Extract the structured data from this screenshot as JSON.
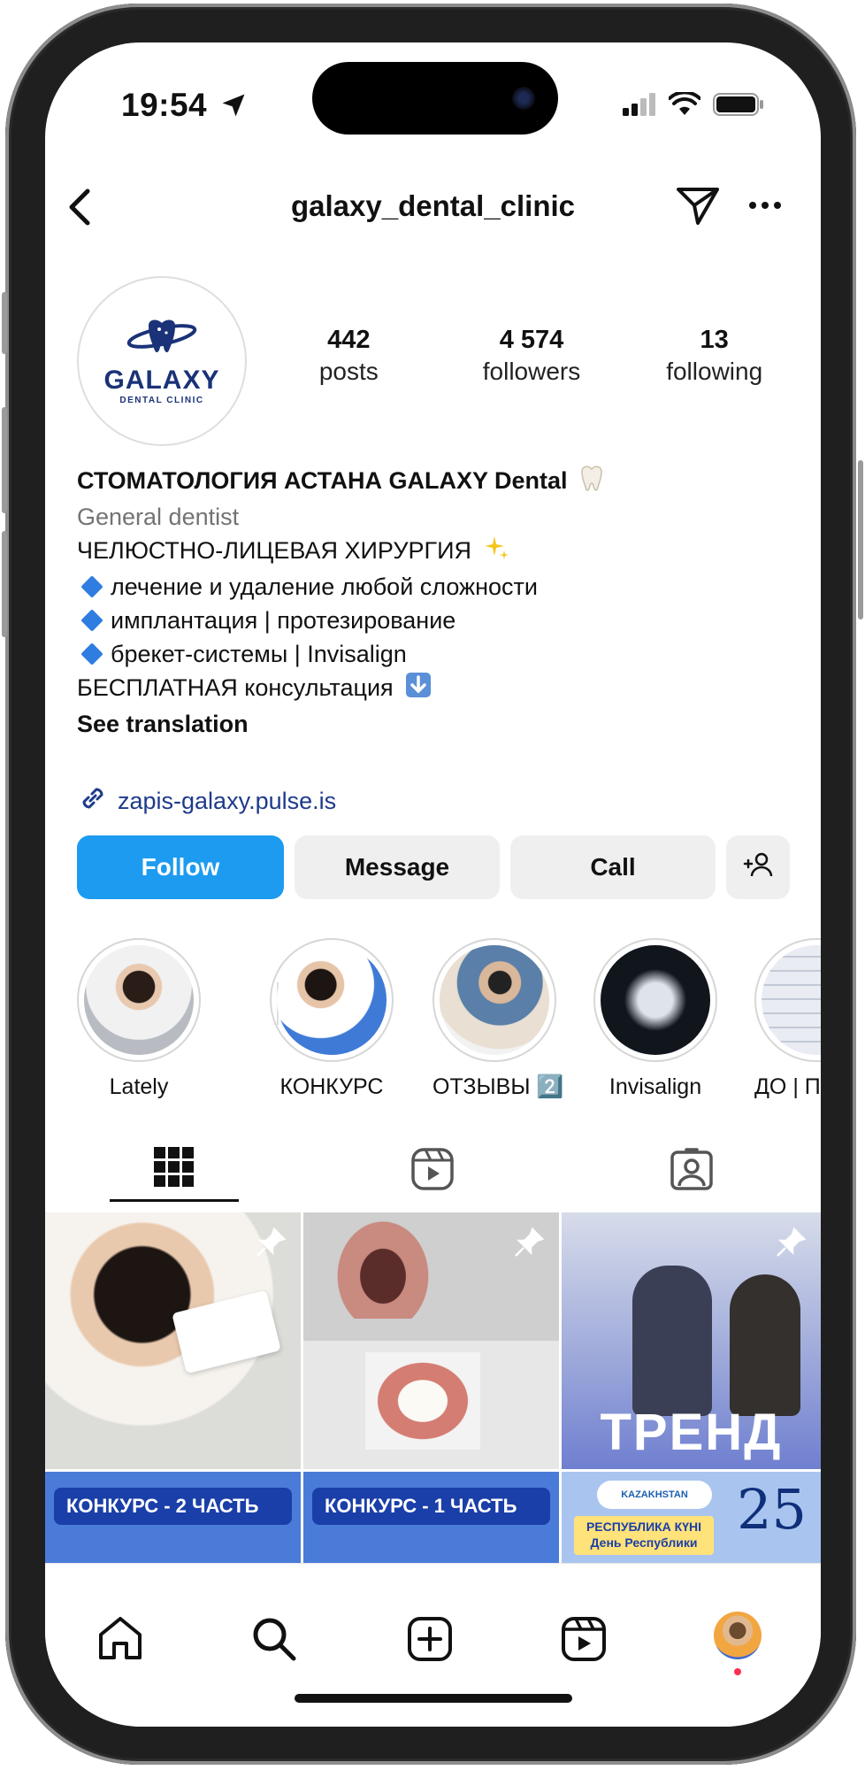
{
  "status_bar": {
    "time": "19:54"
  },
  "header": {
    "username": "galaxy_dental_clinic"
  },
  "profile": {
    "logo_text": "GALAXY",
    "logo_sub": "DENTAL CLINIC",
    "stats": [
      {
        "value": "442",
        "label": "posts"
      },
      {
        "value": "4 574",
        "label": "followers"
      },
      {
        "value": "13",
        "label": "following"
      }
    ],
    "bio": {
      "name": "СТОМАТОЛОГИЯ АСТАНА GALAXY Dental",
      "category": "General dentist",
      "line1": "ЧЕЛЮСТНО-ЛИЦЕВАЯ ХИРУРГИЯ",
      "bullets": [
        "лечение и удаление любой сложности",
        "имплантация | протезирование",
        "брекет-системы | Invisalign"
      ],
      "line_last": "БЕСПЛАТНАЯ консультация",
      "see_translation": "See translation"
    },
    "link": "zapis-galaxy.pulse.is"
  },
  "actions": {
    "follow": "Follow",
    "message": "Message",
    "call": "Call"
  },
  "highlights": [
    {
      "label": "Lately"
    },
    {
      "label": "КОНКУРС"
    },
    {
      "label": "ОТЗЫВЫ 2️⃣"
    },
    {
      "label": "Invisalign"
    },
    {
      "label": "ДО | ПОСЛЕ"
    }
  ],
  "grid": {
    "posts": [
      {
        "caption": ""
      },
      {
        "caption": ""
      },
      {
        "caption": "ТРЕНД"
      },
      {
        "caption": "КОНКУРС - 2 ЧАСТЬ"
      },
      {
        "caption": "КОНКУРС - 1 ЧАСТЬ"
      },
      {
        "caption": "25"
      }
    ],
    "kazakhstan": "KAZAKHSTAN",
    "republic_kz": "РЕСПУБЛИКА КҮНІ",
    "republic_ru": "День Республики"
  },
  "colors": {
    "accent": "#1d9bf0",
    "link": "#1e3a8a",
    "logo": "#1a3278"
  }
}
